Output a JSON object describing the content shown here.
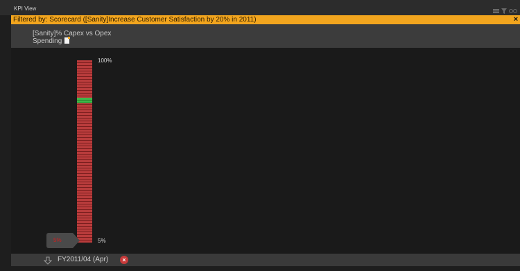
{
  "window": {
    "title": "KPI View",
    "icons": [
      "grid-icon",
      "filter-icon",
      "link-icon"
    ]
  },
  "filter_bar": {
    "text": "Filtered by: Scorecard ([Sanity]Increase Customer Satisfaction by 20% in 2011)",
    "close_label": "×"
  },
  "kpi": {
    "name": "[Sanity]% Capex vs Opex Spending",
    "top_label": "100%",
    "bottom_label": "5%",
    "current_value_label": "5%",
    "current_value": 5,
    "scale_min": 5,
    "scale_max": 100,
    "target_band": {
      "from": 77.6,
      "to": 80.5
    },
    "colors": {
      "bar": "#b93c3c",
      "target": "#3fb84a",
      "value_text": "#d21e1e",
      "filter": "#f2a51e"
    }
  },
  "period": {
    "label": "FY2011/04 (Apr)",
    "remove_label": "×"
  }
}
